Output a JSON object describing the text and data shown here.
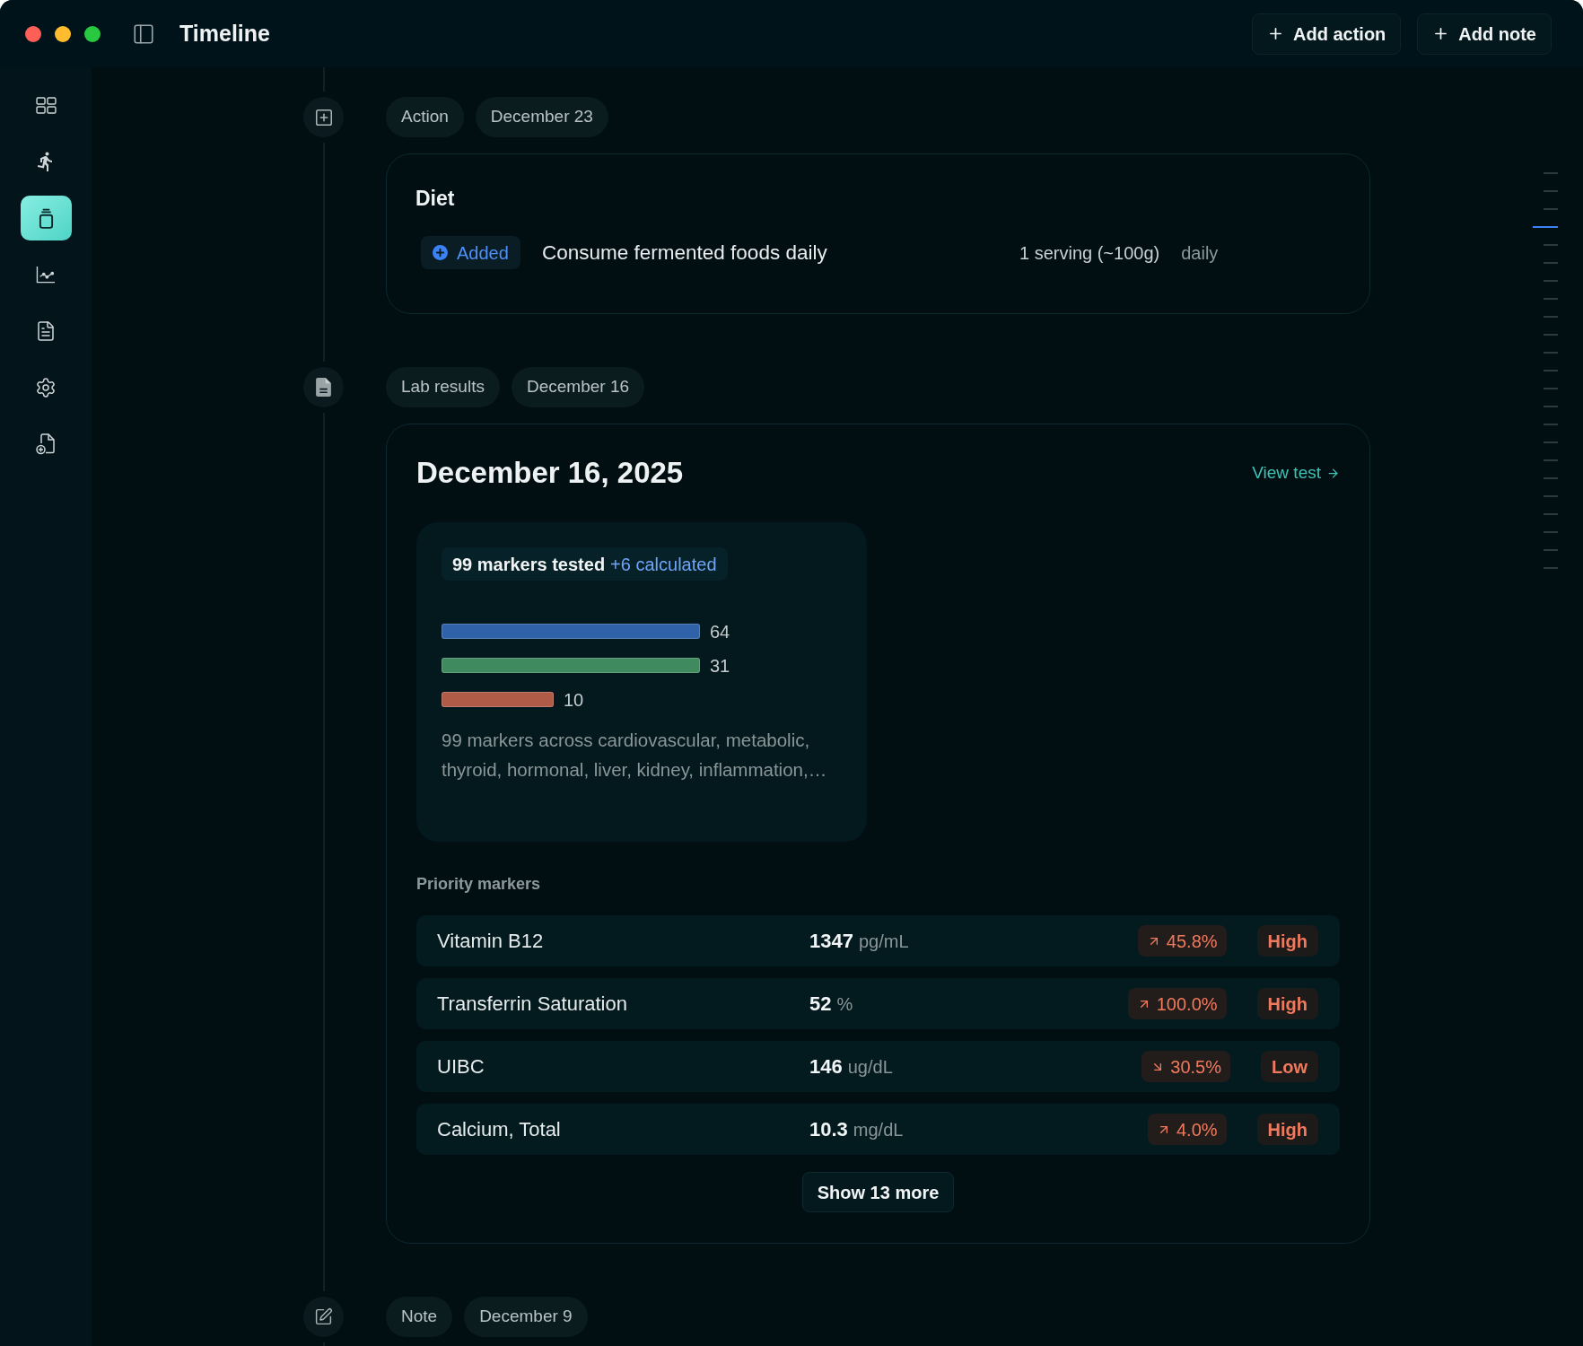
{
  "window": {
    "title": "Timeline"
  },
  "toolbar": {
    "buttons": [
      {
        "label": "Add action"
      },
      {
        "label": "Add note"
      }
    ]
  },
  "sidebar": {
    "items": [
      {
        "selected": false
      },
      {
        "selected": false
      },
      {
        "selected": true
      },
      {
        "selected": false
      },
      {
        "selected": false
      },
      {
        "selected": false
      },
      {
        "selected": false
      }
    ]
  },
  "timeline": {
    "entries": [
      {
        "kind": "action",
        "tag": "Action",
        "date": "December 23",
        "card": {
          "title": "Diet",
          "items": [
            {
              "status": "Added",
              "text": "Consume fermented foods daily",
              "amount": "1 serving (~100g)",
              "frequency": "daily"
            }
          ]
        }
      },
      {
        "kind": "lab_results",
        "tag": "Lab results",
        "date": "December 16",
        "card": {
          "title": "December 16, 2025",
          "link": "View test",
          "summary": {
            "tested": "99 markers tested",
            "calculated": "+6 calculated",
            "bars": [
              {
                "kind": "long",
                "count": "64",
                "color": "#2f62a8"
              },
              {
                "kind": "long",
                "count": "31",
                "color": "#3f8a5e"
              },
              {
                "kind": "short",
                "count": "10",
                "color": "#b05a48"
              }
            ],
            "description": "99 markers across cardiovascular, metabolic, thyroid, hormonal, liver, kidney, inflammation,…"
          },
          "priority": {
            "heading": "Priority markers",
            "rows": [
              {
                "name": "Vitamin B12",
                "value": "1347",
                "unit": "pg/mL",
                "rising": true,
                "change": "45.8%",
                "status": "High"
              },
              {
                "name": "Transferrin Saturation",
                "value": "52",
                "unit": "%",
                "rising": true,
                "change": "100.0%",
                "status": "High"
              },
              {
                "name": "UIBC",
                "value": "146",
                "unit": "ug/dL",
                "rising": false,
                "change": "30.5%",
                "status": "Low"
              },
              {
                "name": "Calcium, Total",
                "value": "10.3",
                "unit": "mg/dL",
                "rising": true,
                "change": "4.0%",
                "status": "High"
              }
            ],
            "more_button": "Show 13 more"
          }
        }
      },
      {
        "kind": "note",
        "tag": "Note",
        "date": "December 9"
      }
    ]
  },
  "scrubber": {
    "ticks": [
      {
        "selected": false
      },
      {
        "selected": false
      },
      {
        "selected": false
      },
      {
        "selected": true
      },
      {
        "selected": false
      },
      {
        "selected": false
      },
      {
        "selected": false
      },
      {
        "selected": false
      },
      {
        "selected": false
      },
      {
        "selected": false
      },
      {
        "selected": false
      },
      {
        "selected": false
      },
      {
        "selected": false
      },
      {
        "selected": false
      },
      {
        "selected": false
      },
      {
        "selected": false
      },
      {
        "selected": false
      },
      {
        "selected": false
      },
      {
        "selected": false
      },
      {
        "selected": false
      },
      {
        "selected": false
      },
      {
        "selected": false
      },
      {
        "selected": false
      }
    ]
  }
}
